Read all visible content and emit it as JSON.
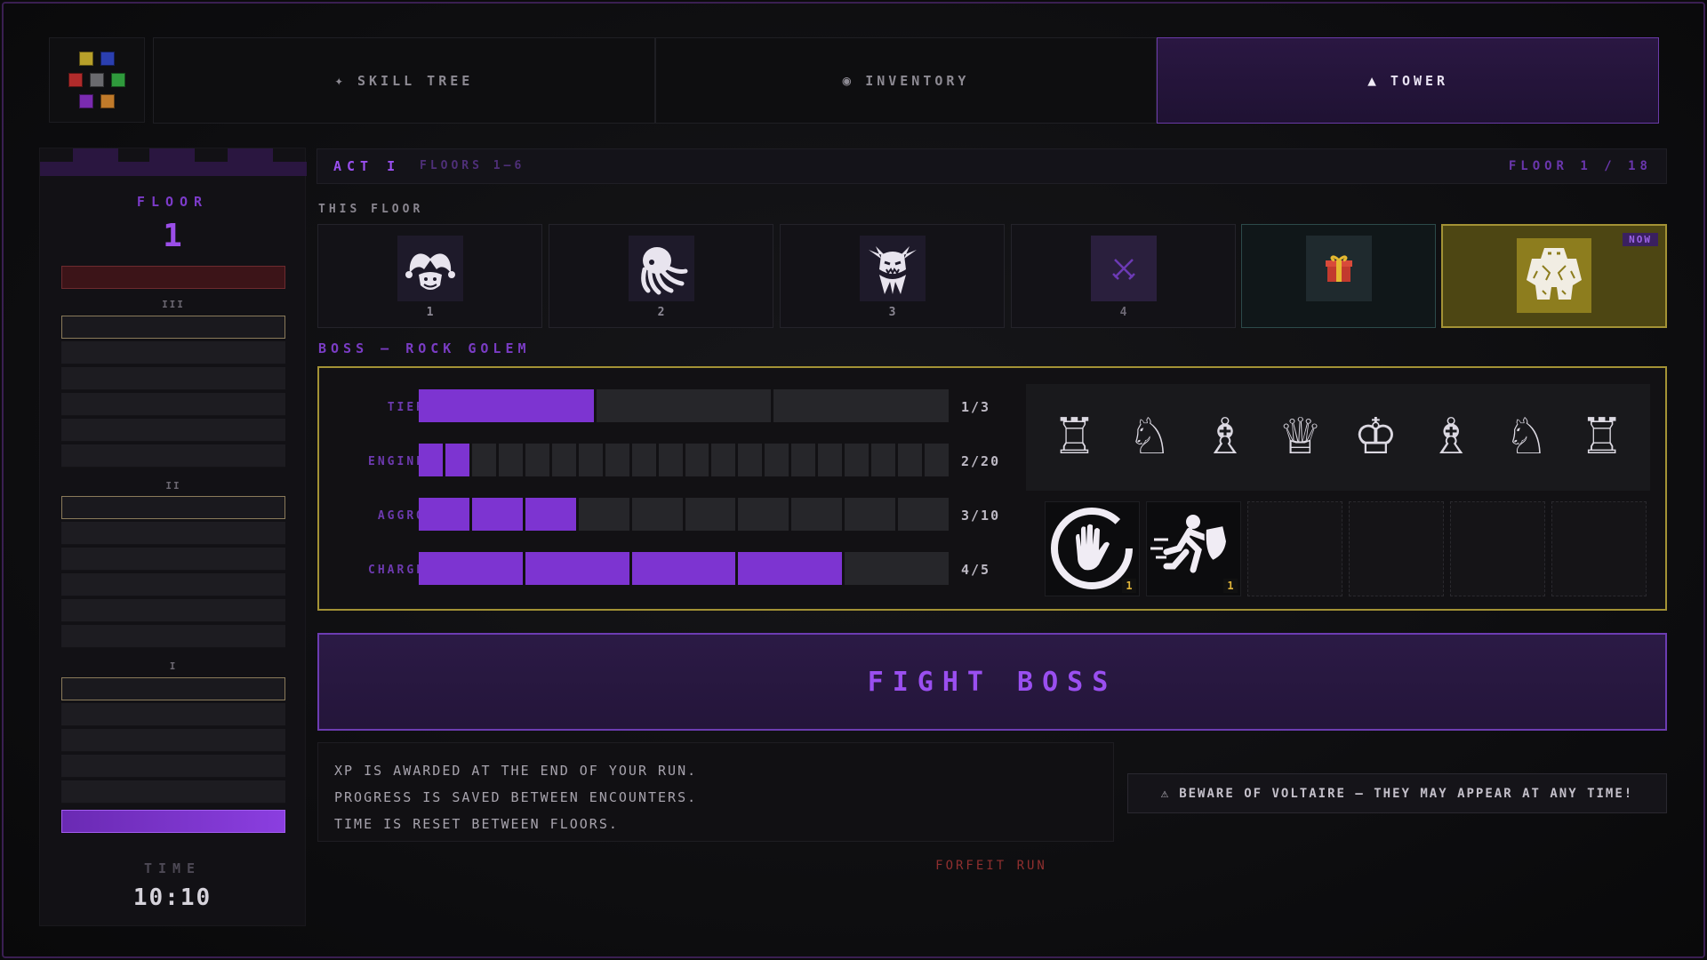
{
  "tabs": [
    {
      "label": "SKILL TREE",
      "icon": "sparkle-icon",
      "glyph": "✦"
    },
    {
      "label": "INVENTORY",
      "icon": "orb-icon",
      "glyph": "◉"
    },
    {
      "label": "TOWER",
      "icon": "triangle-icon",
      "glyph": "▲"
    }
  ],
  "active_tab": "TOWER",
  "sidebar": {
    "floor_label": "FLOOR",
    "floor_value": "1",
    "act_numerals": [
      "III",
      "II",
      "I"
    ],
    "time_label": "TIME",
    "time_value": "10:10"
  },
  "act": {
    "title": "ACT I",
    "subtitle": "FLOORS 1–6",
    "progress": "FLOOR 1 / 18"
  },
  "this_floor_label": "THIS FLOOR",
  "floors": [
    {
      "num": "1",
      "icon": "jester-icon"
    },
    {
      "num": "2",
      "icon": "octopus-icon"
    },
    {
      "num": "3",
      "icon": "gargoyle-icon"
    },
    {
      "num": "4",
      "icon": "crossed-swords-icon"
    },
    {
      "num": "",
      "icon": "gift-icon"
    },
    {
      "num": "",
      "icon": "golem-icon",
      "badge": "NOW"
    }
  ],
  "boss": {
    "label": "BOSS — ROCK GOLEM",
    "stats": [
      {
        "name": "TIER",
        "value": "1/3",
        "current": 1,
        "max": 3
      },
      {
        "name": "ENGINE",
        "value": "2/20",
        "current": 2,
        "max": 20
      },
      {
        "name": "AGGRO",
        "value": "3/10",
        "current": 3,
        "max": 10
      },
      {
        "name": "CHARGE",
        "value": "4/5",
        "current": 4,
        "max": 5
      }
    ],
    "pieces": [
      "♖",
      "♘",
      "♗",
      "♕",
      "♔",
      "♗",
      "♘",
      "♖"
    ],
    "abilities": [
      {
        "icon": "stop-hand-icon",
        "count": "1"
      },
      {
        "icon": "shield-runner-icon",
        "count": "1"
      }
    ]
  },
  "fight_button": "FIGHT BOSS",
  "info_lines": [
    "XP IS AWARDED AT THE END OF YOUR RUN.",
    "PROGRESS IS SAVED BETWEEN ENCOUNTERS.",
    "TIME IS RESET BETWEEN FLOORS."
  ],
  "warning": {
    "icon": "warning-icon",
    "glyph": "⚠",
    "text": "BEWARE OF VOLTAIRE — THEY MAY APPEAR AT ANY TIME!"
  },
  "forfeit_label": "FORFEIT RUN",
  "colors": {
    "accent": "#7d34d1",
    "gold": "#a39235",
    "danger": "#8f2f2f"
  }
}
